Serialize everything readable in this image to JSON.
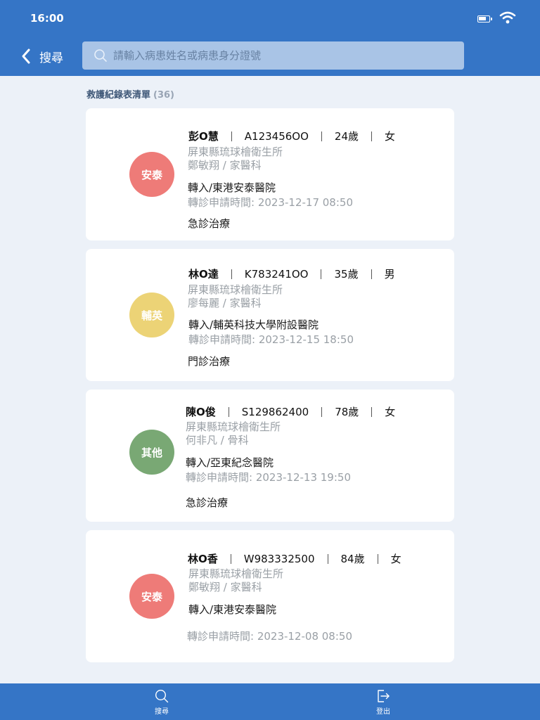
{
  "status_bar": {
    "time": "16:00"
  },
  "header": {
    "back_label": "搜尋",
    "search_placeholder": "請輸入病患姓名或病患身分證號"
  },
  "list": {
    "title": "救護紀錄表清單",
    "count": "(36)",
    "records": [
      {
        "badge": "安泰",
        "badge_color": "#ee7b78",
        "name": "彭O慧",
        "id": "A123456OO",
        "age": "24歲",
        "gender": "女",
        "facility": "屏東縣琉球檜衛生所",
        "doctor": "鄭敏翔 / 家醫科",
        "transfer": "轉入/東港安泰醫院",
        "time": "轉診申請時間: 2023-12-17  08:50",
        "treatment": "急診治療"
      },
      {
        "badge": "輔英",
        "badge_color": "#ecd376",
        "name": "林O達",
        "id": "K783241OO",
        "age": "35歲",
        "gender": "男",
        "facility": "屏東縣琉球檜衛生所",
        "doctor": "廖每麗 / 家醫科",
        "transfer": "轉入/輔英科技大學附設醫院",
        "time": "轉診申請時間: 2023-12-15  18:50",
        "treatment": "門診治療"
      },
      {
        "badge": "其他",
        "badge_color": "#79a874",
        "name": "陳O俊",
        "id": "S129862400",
        "age": "78歲",
        "gender": "女",
        "facility": "屏東縣琉球檜衛生所",
        "doctor": "何非凡 / 骨科",
        "transfer": "轉入/亞東紀念醫院",
        "time": "轉診申請時間: 2023-12-13  19:50",
        "treatment": "急診治療"
      },
      {
        "badge": "安泰",
        "badge_color": "#ee7b78",
        "name": "林O香",
        "id": "W983332500",
        "age": "84歲",
        "gender": "女",
        "facility": "屏東縣琉球檜衛生所",
        "doctor": "鄭敏翔 / 家醫科",
        "transfer": "轉入/東港安泰醫院",
        "time": "轉診申請時間: 2023-12-08  08:50",
        "treatment": ""
      }
    ]
  },
  "bottom_nav": {
    "search_label": "搜尋",
    "logout_label": "登出"
  }
}
